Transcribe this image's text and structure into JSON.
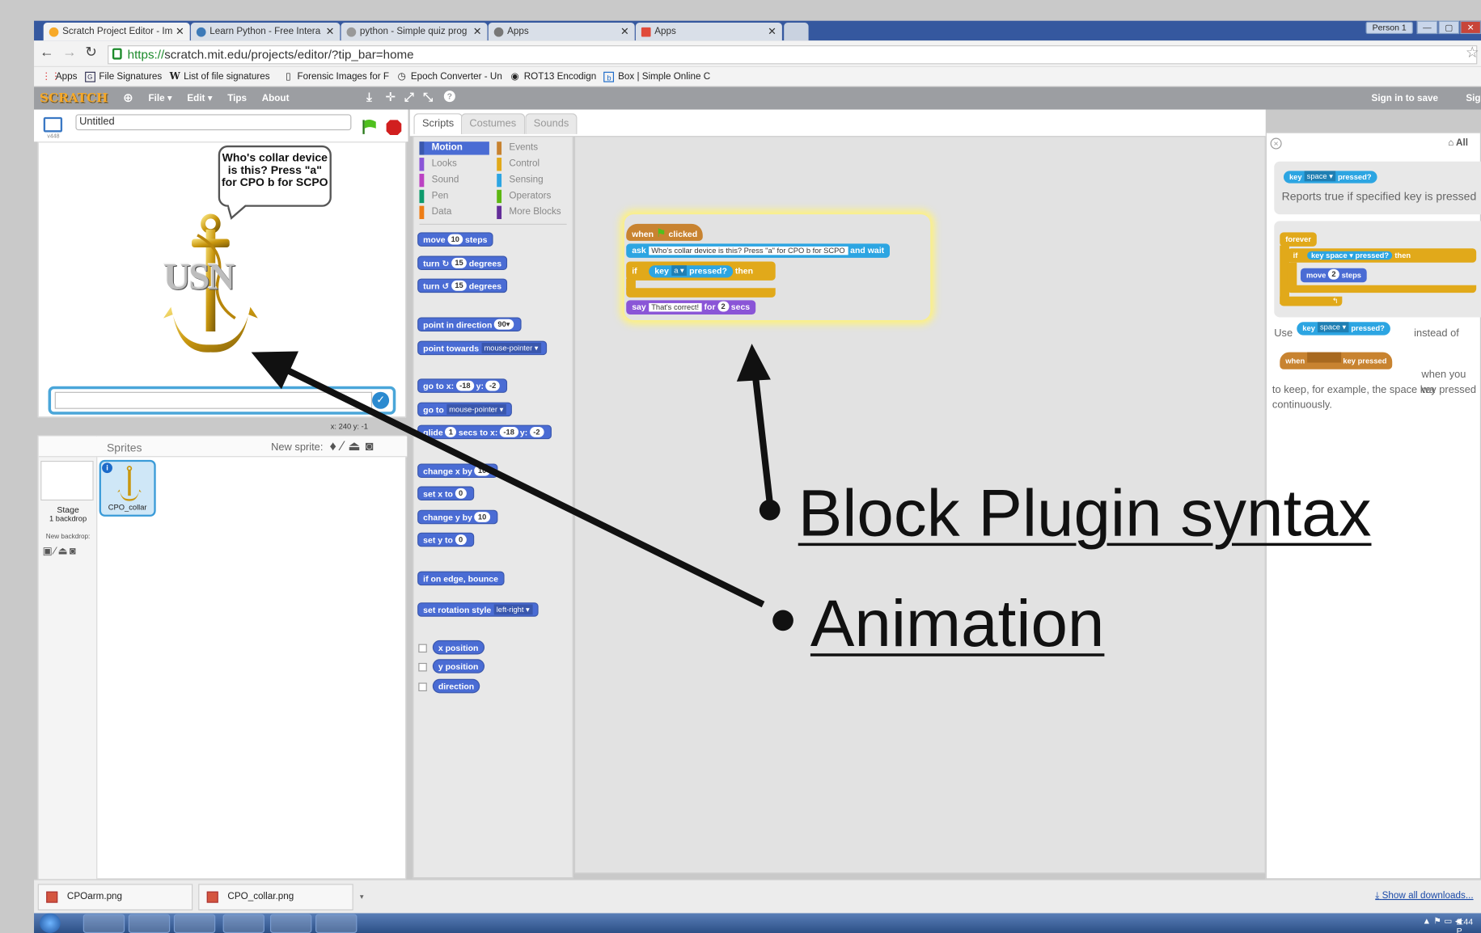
{
  "browser": {
    "tabs": [
      {
        "label": "Scratch Project Editor - Im"
      },
      {
        "label": "Learn Python - Free Intera"
      },
      {
        "label": "python - Simple quiz prog"
      },
      {
        "label": "Apps"
      },
      {
        "label": "Apps"
      }
    ],
    "person": "Person 1",
    "url_scheme": "https://",
    "url_rest": "scratch.mit.edu/projects/editor/?tip_bar=home",
    "bookmarks": [
      "Apps",
      "File Signatures",
      "List of file signatures",
      "Forensic Images for F",
      "Epoch Converter - Un",
      "ROT13 Encodign",
      "Box | Simple Online C"
    ]
  },
  "scratch": {
    "logo": "SCRATCH",
    "menus": [
      "File ▾",
      "Edit ▾",
      "Tips",
      "About"
    ],
    "sign_in": "Sign in to save",
    "sign_cut": "Sig",
    "project_title": "Untitled",
    "version": "v448",
    "bubble_text": "Who's collar device is this? Press \"a\" for CPO b for SCPO",
    "usn_text": "USN",
    "coords": "x: 240  y: -1",
    "sprites_label": "Sprites",
    "new_sprite_label": "New sprite:",
    "stage_label": "Stage",
    "stage_backdrops": "1 backdrop",
    "new_backdrop_label": "New backdrop:",
    "sprite_name": "CPO_collar",
    "tabs": [
      "Scripts",
      "Costumes",
      "Sounds"
    ],
    "categories_left": [
      "Motion",
      "Looks",
      "Sound",
      "Pen",
      "Data"
    ],
    "categories_right": [
      "Events",
      "Control",
      "Sensing",
      "Operators",
      "More Blocks"
    ],
    "blocks": {
      "move": [
        "move",
        "10",
        "steps"
      ],
      "turn_cw": [
        "turn",
        "↻",
        "15",
        "degrees"
      ],
      "turn_ccw": [
        "turn",
        "↺",
        "15",
        "degrees"
      ],
      "point_dir": [
        "point in direction",
        "90▾"
      ],
      "point_towards": [
        "point towards",
        "mouse-pointer ▾"
      ],
      "goto_xy": [
        "go to x:",
        "-18",
        "y:",
        "-2"
      ],
      "goto": [
        "go to",
        "mouse-pointer ▾"
      ],
      "glide": [
        "glide",
        "1",
        "secs to x:",
        "-18",
        "y:",
        "-2"
      ],
      "change_x": [
        "change x by",
        "10"
      ],
      "set_x": [
        "set x to",
        "0"
      ],
      "change_y": [
        "change y by",
        "10"
      ],
      "set_y": [
        "set y to",
        "0"
      ],
      "edge": "if on edge, bounce",
      "rotation": [
        "set rotation style",
        "left-right ▾"
      ],
      "reporters": [
        "x position",
        "y position",
        "direction"
      ]
    },
    "script": {
      "hat": [
        "when",
        "clicked"
      ],
      "ask": [
        "ask",
        "Who's collar device is this? Press \"a\" for CPO b for SCPO",
        "and wait"
      ],
      "if": [
        "if",
        "key",
        "a ▾",
        "pressed?",
        "then"
      ],
      "say": [
        "say",
        "That's correct!",
        "for",
        "2",
        "secs"
      ]
    },
    "tips": {
      "all": "All",
      "reporter": [
        "key",
        "space ▾",
        "pressed?"
      ],
      "desc1": "Reports true if specified key is pressed",
      "forever": "forever",
      "if": "if",
      "then": "then",
      "move": [
        "move",
        "2",
        "steps"
      ],
      "use": "Use",
      "instead_of": "instead of",
      "when_key": [
        "when",
        "key pressed"
      ],
      "when_you": "when you wa",
      "desc2": "to keep, for example, the space key pressed continuously."
    }
  },
  "downloads": {
    "files": [
      "CPOarm.png",
      "CPO_collar.png"
    ],
    "show_all": "Show all downloads..."
  },
  "taskbar": {
    "clock": "2:44 P"
  },
  "annotations": {
    "block_plugin": "Block Plugin syntax",
    "animation": "Animation"
  },
  "colors": {
    "motion": "#4a6cd4",
    "looks": "#8a55d7",
    "sound": "#bb42c3",
    "pen": "#0e9a6c",
    "data": "#ee7d16",
    "events": "#c88330",
    "control": "#e1a91a",
    "sensing": "#2ca5e2",
    "operators": "#5cb712",
    "more_blocks": "#632d99"
  }
}
